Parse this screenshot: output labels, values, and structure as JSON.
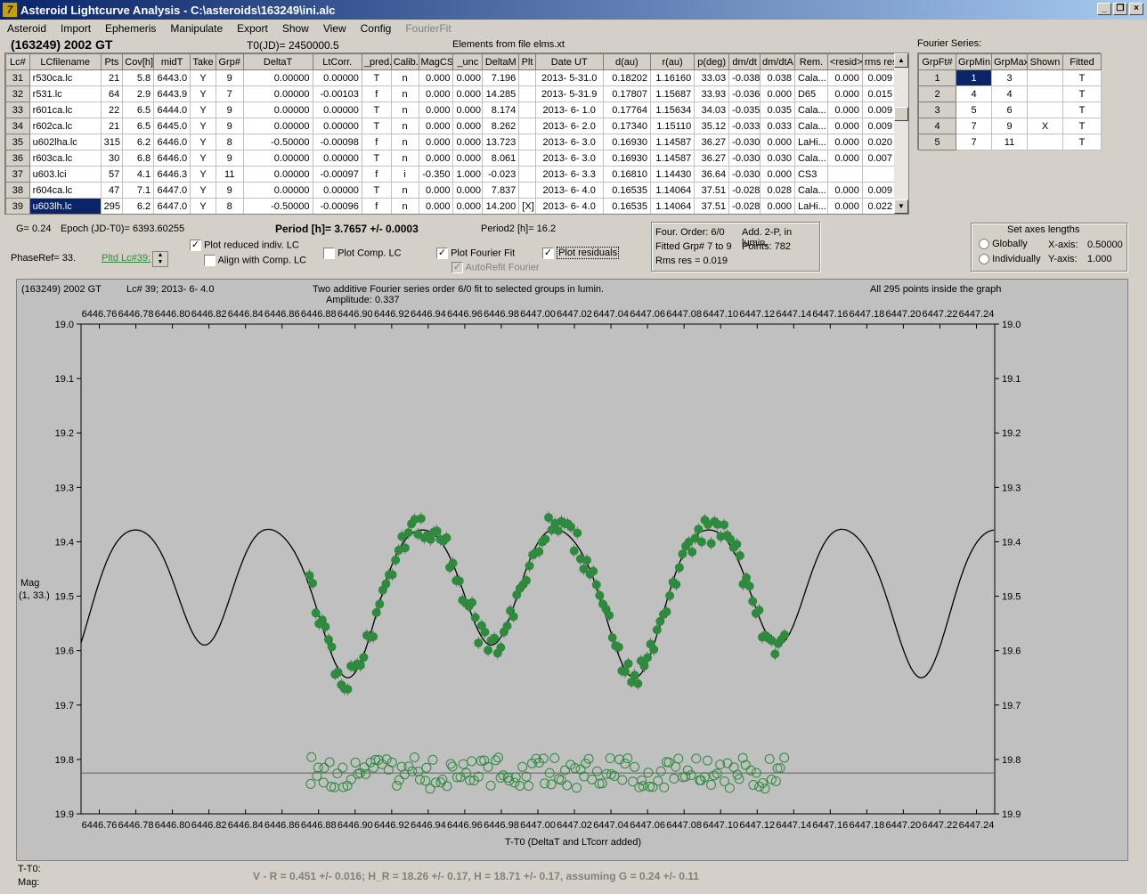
{
  "window": {
    "title": "Asteroid Lightcurve Analysis - C:\\asteroids\\163249\\ini.alc"
  },
  "menu": [
    "Asteroid",
    "Import",
    "Ephemeris",
    "Manipulate",
    "Export",
    "Show",
    "View",
    "Config",
    "FourierFit"
  ],
  "header": {
    "asteroid": "(163249) 2002 GT",
    "t0": "T0(JD)= 2450000.5",
    "elements": "Elements from file elms.xt"
  },
  "lc_table": {
    "columns": [
      "Lc#",
      "LCfilename",
      "Pts",
      "Cov[h]",
      "midT",
      "Take",
      "Grp#",
      "DeltaT",
      "LtCorr.",
      "_pred.",
      "Calib.",
      "MagCS",
      "_unc",
      "DeltaM",
      "Plt",
      "Date UT",
      "d(au)",
      "r(au)",
      "p(deg)",
      "dm/dt",
      "dm/dtA",
      "Rem.",
      "<resid>",
      "rms res"
    ],
    "rows": [
      [
        "31",
        "r530ca.lc",
        "21",
        "5.8",
        "6443.0",
        "Y",
        "9",
        "0.00000",
        "0.00000",
        "T",
        "n",
        "0.000",
        "0.000",
        "7.196",
        "",
        "2013- 5-31.0",
        "0.18202",
        "1.16160",
        "33.03",
        "-0.038",
        "0.038",
        "Cala...",
        "0.000",
        "0.009"
      ],
      [
        "32",
        "r531.lc",
        "64",
        "2.9",
        "6443.9",
        "Y",
        "7",
        "0.00000",
        "-0.00103",
        "f",
        "n",
        "0.000",
        "0.000",
        "14.285",
        "",
        "2013- 5-31.9",
        "0.17807",
        "1.15687",
        "33.93",
        "-0.036",
        "0.000",
        "D65",
        "0.000",
        "0.015"
      ],
      [
        "33",
        "r601ca.lc",
        "22",
        "6.5",
        "6444.0",
        "Y",
        "9",
        "0.00000",
        "0.00000",
        "T",
        "n",
        "0.000",
        "0.000",
        "8.174",
        "",
        "2013- 6- 1.0",
        "0.17764",
        "1.15634",
        "34.03",
        "-0.035",
        "0.035",
        "Cala...",
        "0.000",
        "0.009"
      ],
      [
        "34",
        "r602ca.lc",
        "21",
        "6.5",
        "6445.0",
        "Y",
        "9",
        "0.00000",
        "0.00000",
        "T",
        "n",
        "0.000",
        "0.000",
        "8.262",
        "",
        "2013- 6- 2.0",
        "0.17340",
        "1.15110",
        "35.12",
        "-0.033",
        "0.033",
        "Cala...",
        "0.000",
        "0.009"
      ],
      [
        "35",
        "u602lha.lc",
        "315",
        "6.2",
        "6446.0",
        "Y",
        "8",
        "-0.50000",
        "-0.00098",
        "f",
        "n",
        "0.000",
        "0.000",
        "13.723",
        "",
        "2013- 6- 3.0",
        "0.16930",
        "1.14587",
        "36.27",
        "-0.030",
        "0.000",
        "LaHi...",
        "0.000",
        "0.020"
      ],
      [
        "36",
        "r603ca.lc",
        "30",
        "6.8",
        "6446.0",
        "Y",
        "9",
        "0.00000",
        "0.00000",
        "T",
        "n",
        "0.000",
        "0.000",
        "8.061",
        "",
        "2013- 6- 3.0",
        "0.16930",
        "1.14587",
        "36.27",
        "-0.030",
        "0.030",
        "Cala...",
        "0.000",
        "0.007"
      ],
      [
        "37",
        "u603.lci",
        "57",
        "4.1",
        "6446.3",
        "Y",
        "11",
        "0.00000",
        "-0.00097",
        "f",
        "i",
        "-0.350",
        "1.000",
        "-0.023",
        "",
        "2013- 6- 3.3",
        "0.16810",
        "1.14430",
        "36.64",
        "-0.030",
        "0.000",
        "CS3",
        "",
        ""
      ],
      [
        "38",
        "r604ca.lc",
        "47",
        "7.1",
        "6447.0",
        "Y",
        "9",
        "0.00000",
        "0.00000",
        "T",
        "n",
        "0.000",
        "0.000",
        "7.837",
        "",
        "2013- 6- 4.0",
        "0.16535",
        "1.14064",
        "37.51",
        "-0.028",
        "0.028",
        "Cala...",
        "0.000",
        "0.009"
      ],
      [
        "39",
        "u603lh.lc",
        "295",
        "6.2",
        "6447.0",
        "Y",
        "8",
        "-0.50000",
        "-0.00096",
        "f",
        "n",
        "0.000",
        "0.000",
        "14.200",
        "[X]",
        "2013- 6- 4.0",
        "0.16535",
        "1.14064",
        "37.51",
        "-0.028",
        "0.000",
        "LaHi...",
        "0.000",
        "0.022"
      ]
    ]
  },
  "fourier_series": {
    "title": "Fourier Series:",
    "columns": [
      "GrpFt#",
      "GrpMin",
      "GrpMax",
      "Shown",
      "Fitted"
    ],
    "rows": [
      [
        "1",
        "1",
        "3",
        "",
        "T"
      ],
      [
        "2",
        "4",
        "4",
        "",
        "T"
      ],
      [
        "3",
        "5",
        "6",
        "",
        "T"
      ],
      [
        "4",
        "7",
        "9",
        "X",
        "T"
      ],
      [
        "5",
        "7",
        "11",
        "",
        "T"
      ]
    ]
  },
  "info": {
    "g": "G= 0.24",
    "epoch": "Epoch (JD-T0)= 6393.60255",
    "period": "Period [h]= 3.7657 +/- 0.0003",
    "period2": "Period2 [h]= 16.2",
    "phaseref": "PhaseRef= 33.",
    "pltd": "Pltd Lc#39:"
  },
  "options": {
    "plot_reduced": "Plot reduced indiv. LC",
    "align_comp": "Align with Comp. LC",
    "plot_comp": "Plot Comp. LC",
    "plot_fourier": "Plot Fourier Fit",
    "autorefit": "AutoRefit Fourier",
    "plot_residuals": "Plot residuals"
  },
  "fit_info": {
    "order": "Four. Order:  6/0",
    "add": "Add. 2-P, in lumin.",
    "fitted": "Fitted Grp# 7 to 9",
    "points": "Points: 782",
    "rms": "Rms res     = 0.019"
  },
  "axes_box": {
    "title": "Set axes lengths",
    "globally": "Globally",
    "individually": "Individually",
    "xaxis_label": "X-axis:",
    "xaxis_val": "0.50000",
    "yaxis_label": "Y-axis:",
    "yaxis_val": "1.000"
  },
  "plot": {
    "name": "(163249) 2002 GT",
    "lc": "Lc# 39; 2013- 6- 4.0",
    "desc": "Two additive Fourier series order 6/0 fit to selected groups in lumin.",
    "amplitude": "Amplitude: 0.337",
    "inside": "All 295 points inside the graph",
    "ylabel": "Mag",
    "ylabel2": "(1, 33.)",
    "xlabel": "T-T0 (DeltaT and LTcorr added)"
  },
  "chart_data": {
    "type": "scatter",
    "xlim": [
      6446.75,
      6447.25
    ],
    "ylim": [
      19.9,
      19.0
    ],
    "x_ticks": [
      "6446.76",
      "6446.78",
      "6446.80",
      "6446.82",
      "6446.84",
      "6446.86",
      "6446.88",
      "6446.90",
      "6446.92",
      "6446.94",
      "6446.96",
      "6446.98",
      "6447.00",
      "6447.02",
      "6447.04",
      "6447.06",
      "6447.08",
      "6447.10",
      "6447.12",
      "6447.14",
      "6447.16",
      "6447.18",
      "6447.20",
      "6447.22",
      "6447.24"
    ],
    "y_ticks": [
      "19.0",
      "19.1",
      "19.2",
      "19.3",
      "19.4",
      "19.5",
      "19.6",
      "19.7",
      "19.8",
      "19.9"
    ],
    "fit_period_days": 0.1569,
    "fit_mean": 19.485,
    "residual_baseline": 19.825,
    "data_x_range": [
      6446.875,
      6447.135
    ],
    "colors": {
      "points": "#2e8b3e",
      "fit": "#000000",
      "background": "#c0c0c0"
    }
  },
  "status": {
    "t_t0": "T-T0:",
    "mag": "Mag:",
    "color": "V - R = 0.451 +/- 0.016; H_R = 18.26 +/- 0.17, H = 18.71 +/- 0.17, assuming G = 0.24 +/- 0.11"
  }
}
